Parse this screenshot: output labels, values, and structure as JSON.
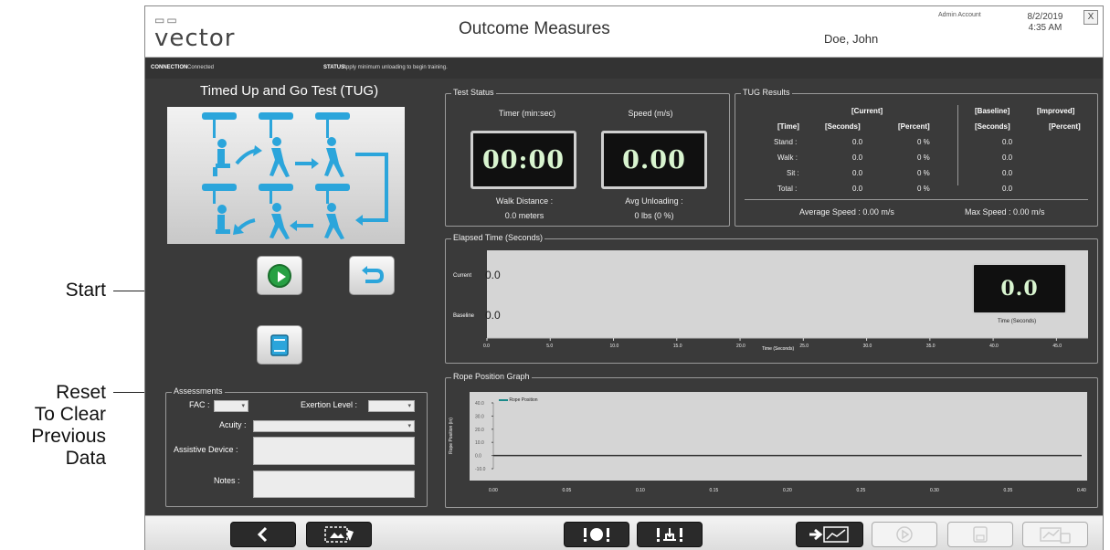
{
  "callouts": {
    "start": "Start",
    "reset_line1": "Reset",
    "reset_line2": "To Clear",
    "reset_line3": "Previous",
    "reset_line4": "Data"
  },
  "header": {
    "logo_text": "vector",
    "title": "Outcome Measures",
    "patient_name": "Doe, John",
    "account": "Admin Account",
    "date": "8/2/2019",
    "time": "4:35 AM",
    "close_label": "X"
  },
  "status_bar": {
    "connection_label": "CONNECTION",
    "connection_value": "Connected",
    "status_label": "STATUS:",
    "status_value": "Apply minimum unloading to begin training."
  },
  "left": {
    "test_title": "Timed Up and Go Test (TUG)"
  },
  "assessments": {
    "legend": "Assessments",
    "fac_label": "FAC :",
    "exertion_label": "Exertion Level :",
    "acuity_label": "Acuity :",
    "assistive_label": "Assistive Device :",
    "notes_label": "Notes :"
  },
  "test_status": {
    "legend": "Test Status",
    "timer_label": "Timer (min:sec)",
    "speed_label": "Speed (m/s)",
    "timer_value": "00:00",
    "speed_value": "0.00",
    "walk_distance_label": "Walk Distance :",
    "walk_distance_value": "0.0 meters",
    "avg_unloading_label": "Avg Unloading :",
    "avg_unloading_value": "0  lbs (0 %)"
  },
  "tug_results": {
    "legend": "TUG Results",
    "group_current": "[Current]",
    "group_baseline": "[Baseline]",
    "group_improved": "[Improved]",
    "col_time": "[Time]",
    "col_seconds": "[Seconds]",
    "col_percent": "[Percent]",
    "col_b_seconds": "[Seconds]",
    "col_i_percent": "[Percent]",
    "rows": [
      {
        "label": "Stand :",
        "seconds": "0.0",
        "percent": "0 %",
        "baseline": "0.0"
      },
      {
        "label": "Walk :",
        "seconds": "0.0",
        "percent": "0 %",
        "baseline": "0.0"
      },
      {
        "label": "Sit :",
        "seconds": "0.0",
        "percent": "0 %",
        "baseline": "0.0"
      },
      {
        "label": "Total :",
        "seconds": "0.0",
        "percent": "0 %",
        "baseline": "0.0"
      }
    ],
    "average_speed": "Average Speed : 0.00 m/s",
    "max_speed": "Max Speed : 0.00 m/s"
  },
  "elapsed": {
    "legend": "Elapsed Time (Seconds)",
    "current_label": "Current",
    "current_value": "0.0",
    "baseline_label": "Baseline",
    "baseline_value": "0.0",
    "display_value": "0.0",
    "display_caption": "Time (Seconds)",
    "xlabel": "Time (Seconds)",
    "ticks": [
      "0.0",
      "5.0",
      "10.0",
      "15.0",
      "20.0",
      "25.0",
      "30.0",
      "35.0",
      "40.0",
      "45.0"
    ]
  },
  "rope": {
    "legend": "Rope Position Graph",
    "legend_entry": "Rope Position",
    "ylabel": "Rope Position (in)",
    "yticks": [
      "40.0",
      "30.0",
      "20.0",
      "10.0",
      "0.0",
      "-10.0"
    ],
    "xticks": [
      "0.00",
      "0.05",
      "0.10",
      "0.15",
      "0.20",
      "0.25",
      "0.30",
      "0.35",
      "0.40"
    ]
  },
  "chart_data": [
    {
      "type": "bar",
      "categories": [
        "Current",
        "Baseline"
      ],
      "values": [
        0.0,
        0.0
      ],
      "xlabel": "Time (Seconds)",
      "xlim": [
        0,
        47.5
      ]
    },
    {
      "type": "line",
      "series": [
        {
          "name": "Rope Position",
          "x": [
            0.0,
            0.4
          ],
          "y": [
            0.0,
            0.0
          ]
        }
      ],
      "ylabel": "Rope Position (in)",
      "xlim": [
        0,
        0.4
      ],
      "ylim": [
        -10,
        40
      ]
    }
  ],
  "colors": {
    "play": "#27a043",
    "icon_blue": "#2ba5db",
    "digit": "#d9f5d0"
  },
  "icons": [
    "back-icon",
    "screenshot-icon",
    "alert-icon",
    "adjust-icon",
    "export-icon",
    "replay-icon",
    "save-icon",
    "chart-save-icon"
  ]
}
